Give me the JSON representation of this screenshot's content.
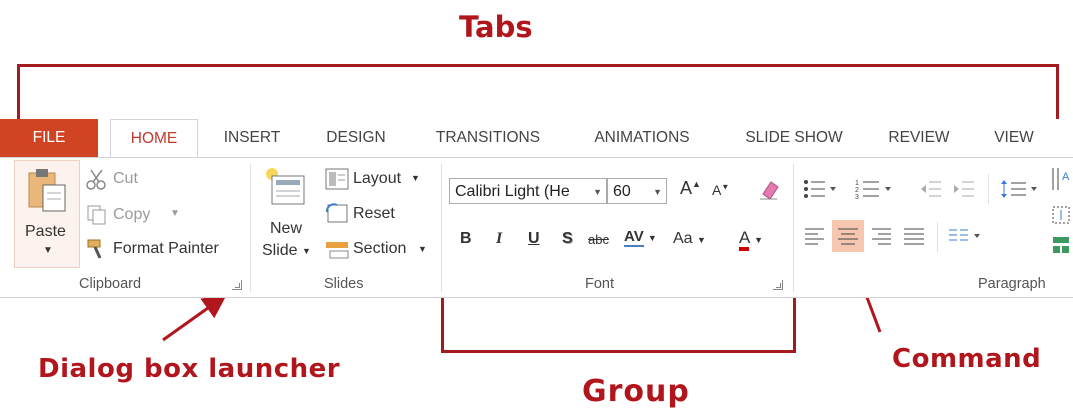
{
  "annotations": {
    "tabs": "Tabs",
    "dialog_box_launcher": "Dialog box launcher",
    "command": "Command",
    "group": "Group"
  },
  "tabs": [
    "FILE",
    "HOME",
    "INSERT",
    "DESIGN",
    "TRANSITIONS",
    "ANIMATIONS",
    "SLIDE SHOW",
    "REVIEW",
    "VIEW"
  ],
  "clipboard": {
    "paste": "Paste",
    "cut": "Cut",
    "copy": "Copy",
    "format_painter": "Format Painter",
    "label": "Clipboard"
  },
  "slides": {
    "new_slide_line1": "New",
    "new_slide_line2": "Slide",
    "layout": "Layout",
    "reset": "Reset",
    "section": "Section",
    "label": "Slides"
  },
  "font": {
    "font_name": "Calibri Light (He",
    "font_size": "60",
    "grow": "A",
    "shrink": "A",
    "bold": "B",
    "italic": "I",
    "underline": "U",
    "shadow": "S",
    "strikethrough": "abc",
    "spacing": "AV",
    "change_case": "Aa",
    "font_color": "A",
    "label": "Font"
  },
  "paragraph": {
    "label": "Paragraph"
  },
  "colors": {
    "accent": "#b0161c",
    "file_tab": "#d04423",
    "active_tab_text": "#c0392b",
    "command_highlight": "#f5c6b0"
  }
}
